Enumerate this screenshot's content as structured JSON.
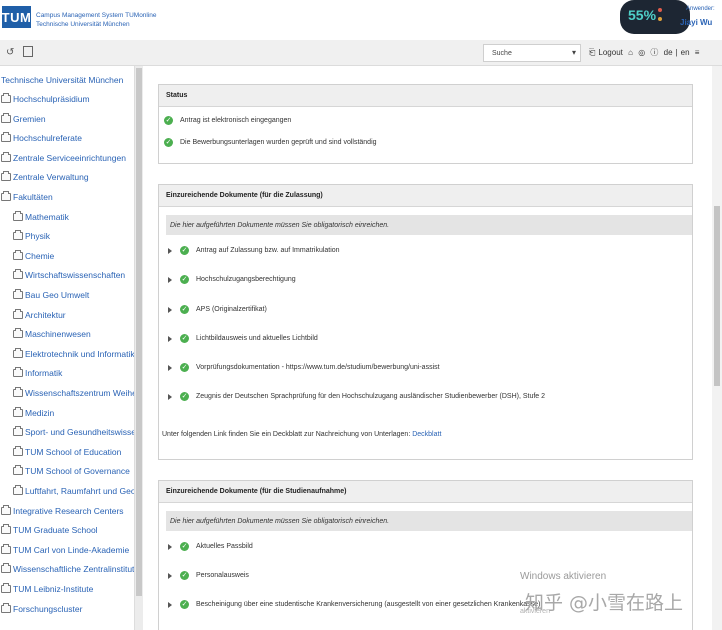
{
  "header": {
    "logo_text": "TUM",
    "system_title_line1": "Campus Management System TUMonline",
    "system_title_line2": "Technische Universität München",
    "progress_percent": "55%",
    "user_label": "Anwender:",
    "user_name": "Jiayi Wu"
  },
  "toolbar": {
    "search_value": "Suche",
    "logout_label": "Logout",
    "lang_de": "de",
    "lang_en": "en"
  },
  "sidebar": {
    "root": "Technische Universität München",
    "items": [
      {
        "label": "Hochschulpräsidium",
        "level": 0
      },
      {
        "label": "Gremien",
        "level": 0
      },
      {
        "label": "Hochschulreferate",
        "level": 0
      },
      {
        "label": "Zentrale Serviceeinrichtungen",
        "level": 0
      },
      {
        "label": "Zentrale Verwaltung",
        "level": 0
      },
      {
        "label": "Fakultäten",
        "level": 0
      },
      {
        "label": "Mathematik",
        "level": 1
      },
      {
        "label": "Physik",
        "level": 1
      },
      {
        "label": "Chemie",
        "level": 1
      },
      {
        "label": "Wirtschaftswissenschaften",
        "level": 1
      },
      {
        "label": "Bau Geo Umwelt",
        "level": 1
      },
      {
        "label": "Architektur",
        "level": 1
      },
      {
        "label": "Maschinenwesen",
        "level": 1
      },
      {
        "label": "Elektrotechnik und Informatik",
        "level": 1
      },
      {
        "label": "Informatik",
        "level": 1
      },
      {
        "label": "Wissenschaftszentrum Weihenstephan",
        "level": 1
      },
      {
        "label": "Medizin",
        "level": 1
      },
      {
        "label": "Sport- und Gesundheitswissenschaften",
        "level": 1
      },
      {
        "label": "TUM School of Education",
        "level": 1
      },
      {
        "label": "TUM School of Governance",
        "level": 1
      },
      {
        "label": "Luftfahrt, Raumfahrt und Geodäsie",
        "level": 1
      },
      {
        "label": "Integrative Research Centers",
        "level": 0
      },
      {
        "label": "TUM Graduate School",
        "level": 0
      },
      {
        "label": "TUM Carl von Linde-Akademie",
        "level": 0
      },
      {
        "label": "Wissenschaftliche Zentralinstitute",
        "level": 0
      },
      {
        "label": "TUM Leibniz-Institute",
        "level": 0
      },
      {
        "label": "Forschungscluster",
        "level": 0
      }
    ]
  },
  "status_box": {
    "heading": "Status",
    "lines": [
      "Antrag ist elektronisch eingegangen",
      "Die Bewerbungsunterlagen wurden geprüft und sind vollständig"
    ]
  },
  "admission_box": {
    "heading": "Einzureichende Dokumente (für die Zulassung)",
    "hint": "Die hier aufgeführten Dokumente müssen Sie obligatorisch einreichen.",
    "docs": [
      "Antrag auf Zulassung bzw. auf Immatrikulation",
      "Hochschulzugangsberechtigung",
      "APS (Originalzertifikat)",
      "Lichtbildausweis und aktuelles Lichtbild",
      "Vorprüfungsdokumentation - https://www.tum.de/studium/bewerbung/uni-assist",
      "Zeugnis der Deutschen Sprachprüfung für den Hochschulzugang ausländischer Studienbewerber (DSH), Stufe 2"
    ],
    "footer_text": "Unter folgenden Link finden Sie ein Deckblatt zur Nachreichung von Unterlagen:",
    "footer_link": "Deckblatt"
  },
  "enrollment_box": {
    "heading": "Einzureichende Dokumente (für die Studienaufnahme)",
    "hint": "Die hier aufgeführten Dokumente müssen Sie obligatorisch einreichen.",
    "docs": [
      "Aktuelles Passbild",
      "Personalausweis",
      "Bescheinigung über eine studentische Krankenversicherung (ausgestellt von einer gesetzlichen Krankenkasse)"
    ]
  },
  "watermark": {
    "windows_line1": "Windows aktivieren",
    "windows_line2": "aktivieren",
    "zhihu": "知乎 @小雪在路上"
  },
  "colors": {
    "tum_blue": "#1f5fa8",
    "link_blue": "#2a63b5",
    "check_green": "#4caf50"
  }
}
